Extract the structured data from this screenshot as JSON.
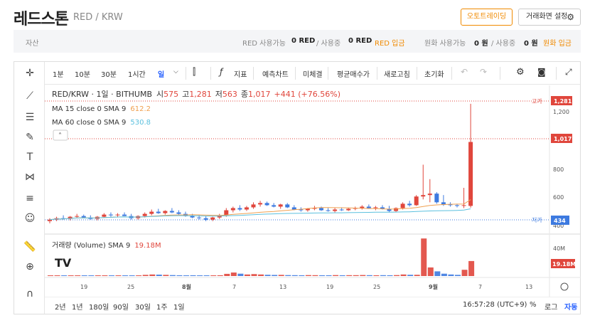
{
  "header": {
    "title": "레드스톤",
    "pair": "RED / KRW",
    "auto_order_label": "오토트레이딩",
    "screen_settings_label": "거래화면 설정"
  },
  "asset_bar": {
    "asset_label": "자산",
    "red_available_label": "RED 사용가능",
    "red_available_value": "0 RED",
    "red_in_use_label": "/ 사용중",
    "red_in_use_value": "0 RED",
    "red_deposit_label": "RED 입금",
    "krw_available_label": "원화 사용가능",
    "krw_available_value": "0 원",
    "krw_in_use_label": "/ 사용중",
    "krw_in_use_value": "0 원",
    "krw_deposit_label": "원화 입금"
  },
  "toolbar": {
    "intervals": [
      "1분",
      "10분",
      "30분",
      "1시간",
      "일"
    ],
    "selected_interval": "일",
    "indicator_label": "지표",
    "predict_chart_label": "예측차트",
    "unfilled_label": "미체결",
    "avg_buy_label": "평균매수가",
    "refresh_label": "새로고침",
    "reset_label": "초기화"
  },
  "legend": {
    "symbol_line": "RED/KRW · 1일 · BITHUMB",
    "open_label": "시",
    "open_value": "575",
    "high_label": "고",
    "high_value": "1,281",
    "low_label": "저",
    "low_value": "563",
    "close_label": "종",
    "close_value": "1,017",
    "change_value": "+441 (+76.56%)",
    "ma15_label": "MA 15 close 0 SMA 9",
    "ma15_value": "612.2",
    "ma60_label": "MA 60 close 0 SMA 9",
    "ma60_value": "530.8",
    "volume_label": "거래량 (Volume) SMA 9",
    "volume_value": "19.18M"
  },
  "price_axis": {
    "ticks": [
      "1,200",
      "1,000",
      "800",
      "600",
      "400"
    ],
    "high_tag_label": "고가",
    "high_tag_value": "1,281",
    "close_tag_value": "1,017",
    "low_tag_label": "저가",
    "low_tag_value": "434",
    "volume_ticks": [
      "40M"
    ],
    "volume_tag_value": "19.18M"
  },
  "date_axis": {
    "labels": [
      "19",
      "25",
      "8월",
      "7",
      "13",
      "19",
      "25",
      "9월",
      "7",
      "13"
    ]
  },
  "bottom_bar": {
    "ranges": [
      "2년",
      "1년",
      "180일",
      "90일",
      "30일",
      "1주",
      "1일"
    ],
    "clock": "16:57:28 (UTC+9)",
    "percent_label": "%",
    "log_label": "로그",
    "auto_label": "자동"
  },
  "colors": {
    "up": "#e0463c",
    "down": "#3d7ae0",
    "ma15": "#f0a050",
    "ma60": "#5bc0de",
    "accent": "#f08a00"
  },
  "chart_data": {
    "type": "candlestick",
    "title": "RED/KRW · 1일 · BITHUMB",
    "ylim": [
      400,
      1300
    ],
    "candles": [
      {
        "o": 470,
        "h": 490,
        "l": 455,
        "c": 480
      },
      {
        "o": 480,
        "h": 500,
        "l": 470,
        "c": 490
      },
      {
        "o": 490,
        "h": 510,
        "l": 480,
        "c": 485
      },
      {
        "o": 485,
        "h": 505,
        "l": 475,
        "c": 500
      },
      {
        "o": 500,
        "h": 520,
        "l": 490,
        "c": 505
      },
      {
        "o": 505,
        "h": 515,
        "l": 490,
        "c": 495
      },
      {
        "o": 495,
        "h": 510,
        "l": 480,
        "c": 485
      },
      {
        "o": 485,
        "h": 505,
        "l": 475,
        "c": 500
      },
      {
        "o": 500,
        "h": 525,
        "l": 495,
        "c": 515
      },
      {
        "o": 515,
        "h": 530,
        "l": 500,
        "c": 510
      },
      {
        "o": 510,
        "h": 525,
        "l": 495,
        "c": 515
      },
      {
        "o": 515,
        "h": 530,
        "l": 505,
        "c": 505
      },
      {
        "o": 505,
        "h": 520,
        "l": 480,
        "c": 490
      },
      {
        "o": 490,
        "h": 510,
        "l": 480,
        "c": 505
      },
      {
        "o": 505,
        "h": 530,
        "l": 495,
        "c": 520
      },
      {
        "o": 520,
        "h": 550,
        "l": 510,
        "c": 535
      },
      {
        "o": 535,
        "h": 555,
        "l": 520,
        "c": 525
      },
      {
        "o": 525,
        "h": 545,
        "l": 515,
        "c": 540
      },
      {
        "o": 540,
        "h": 560,
        "l": 525,
        "c": 530
      },
      {
        "o": 530,
        "h": 545,
        "l": 515,
        "c": 520
      },
      {
        "o": 520,
        "h": 535,
        "l": 500,
        "c": 505
      },
      {
        "o": 505,
        "h": 520,
        "l": 490,
        "c": 495
      },
      {
        "o": 495,
        "h": 510,
        "l": 480,
        "c": 490
      },
      {
        "o": 490,
        "h": 505,
        "l": 470,
        "c": 480
      },
      {
        "o": 480,
        "h": 500,
        "l": 470,
        "c": 495
      },
      {
        "o": 495,
        "h": 520,
        "l": 485,
        "c": 510
      },
      {
        "o": 510,
        "h": 560,
        "l": 500,
        "c": 545
      },
      {
        "o": 545,
        "h": 570,
        "l": 530,
        "c": 560
      },
      {
        "o": 560,
        "h": 580,
        "l": 540,
        "c": 550
      },
      {
        "o": 550,
        "h": 575,
        "l": 540,
        "c": 565
      },
      {
        "o": 565,
        "h": 600,
        "l": 555,
        "c": 585
      },
      {
        "o": 585,
        "h": 610,
        "l": 570,
        "c": 595
      },
      {
        "o": 595,
        "h": 605,
        "l": 575,
        "c": 580
      },
      {
        "o": 580,
        "h": 595,
        "l": 565,
        "c": 570
      },
      {
        "o": 570,
        "h": 590,
        "l": 555,
        "c": 585
      },
      {
        "o": 585,
        "h": 595,
        "l": 560,
        "c": 565
      },
      {
        "o": 565,
        "h": 580,
        "l": 545,
        "c": 550
      },
      {
        "o": 550,
        "h": 565,
        "l": 535,
        "c": 545
      },
      {
        "o": 545,
        "h": 560,
        "l": 535,
        "c": 555
      },
      {
        "o": 555,
        "h": 575,
        "l": 545,
        "c": 560
      },
      {
        "o": 560,
        "h": 570,
        "l": 540,
        "c": 545
      },
      {
        "o": 545,
        "h": 560,
        "l": 535,
        "c": 540
      },
      {
        "o": 540,
        "h": 560,
        "l": 530,
        "c": 550
      },
      {
        "o": 550,
        "h": 565,
        "l": 540,
        "c": 545
      },
      {
        "o": 545,
        "h": 560,
        "l": 540,
        "c": 555
      },
      {
        "o": 555,
        "h": 570,
        "l": 545,
        "c": 560
      },
      {
        "o": 560,
        "h": 580,
        "l": 550,
        "c": 570
      },
      {
        "o": 570,
        "h": 585,
        "l": 555,
        "c": 560
      },
      {
        "o": 560,
        "h": 575,
        "l": 545,
        "c": 565
      },
      {
        "o": 565,
        "h": 580,
        "l": 550,
        "c": 555
      },
      {
        "o": 555,
        "h": 575,
        "l": 530,
        "c": 540
      },
      {
        "o": 540,
        "h": 565,
        "l": 530,
        "c": 560
      },
      {
        "o": 560,
        "h": 600,
        "l": 550,
        "c": 590
      },
      {
        "o": 590,
        "h": 610,
        "l": 570,
        "c": 580
      },
      {
        "o": 580,
        "h": 650,
        "l": 575,
        "c": 640
      },
      {
        "o": 640,
        "h": 860,
        "l": 620,
        "c": 650
      },
      {
        "o": 650,
        "h": 760,
        "l": 600,
        "c": 660
      },
      {
        "o": 660,
        "h": 670,
        "l": 590,
        "c": 600
      },
      {
        "o": 600,
        "h": 650,
        "l": 575,
        "c": 585
      },
      {
        "o": 585,
        "h": 600,
        "l": 570,
        "c": 580
      },
      {
        "o": 580,
        "h": 590,
        "l": 565,
        "c": 575
      },
      {
        "o": 575,
        "h": 700,
        "l": 560,
        "c": 580
      },
      {
        "o": 575,
        "h": 1281,
        "l": 563,
        "c": 1017
      }
    ],
    "volume": [
      0.6,
      0.8,
      0.5,
      0.6,
      0.7,
      0.6,
      0.5,
      0.6,
      0.8,
      0.7,
      0.7,
      0.6,
      0.6,
      0.7,
      1.5,
      2.0,
      1.8,
      1.5,
      1.2,
      1.0,
      0.9,
      1.0,
      0.9,
      0.8,
      0.9,
      1.0,
      2.8,
      4.5,
      3.0,
      2.0,
      2.5,
      2.0,
      1.6,
      1.4,
      1.5,
      1.2,
      1.1,
      1.0,
      1.2,
      1.1,
      1.0,
      1.0,
      1.2,
      1.0,
      1.1,
      1.1,
      1.3,
      1.1,
      1.0,
      1.1,
      1.0,
      1.2,
      2.0,
      1.6,
      1.6,
      48.0,
      11.0,
      6.0,
      3.0,
      2.0,
      1.5,
      8.0,
      19.18
    ]
  }
}
